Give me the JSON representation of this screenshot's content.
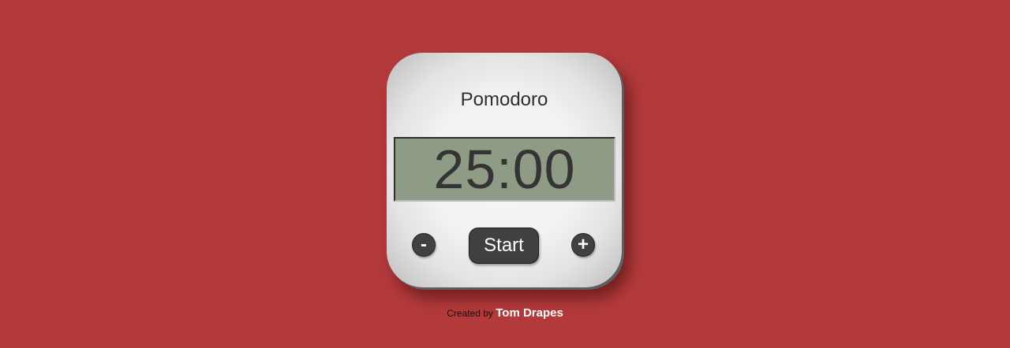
{
  "app": {
    "title": "Pomodoro"
  },
  "timer": {
    "display": "25:00"
  },
  "controls": {
    "decrease_label": "-",
    "start_label": "Start",
    "increase_label": "+"
  },
  "footer": {
    "prefix": "Created by",
    "author": "Tom Drapes"
  },
  "colors": {
    "background": "#b33a3b",
    "device_face": "#f3f2f3",
    "lcd_screen": "#8f9c85",
    "button": "#404040",
    "digit": "#333433"
  }
}
